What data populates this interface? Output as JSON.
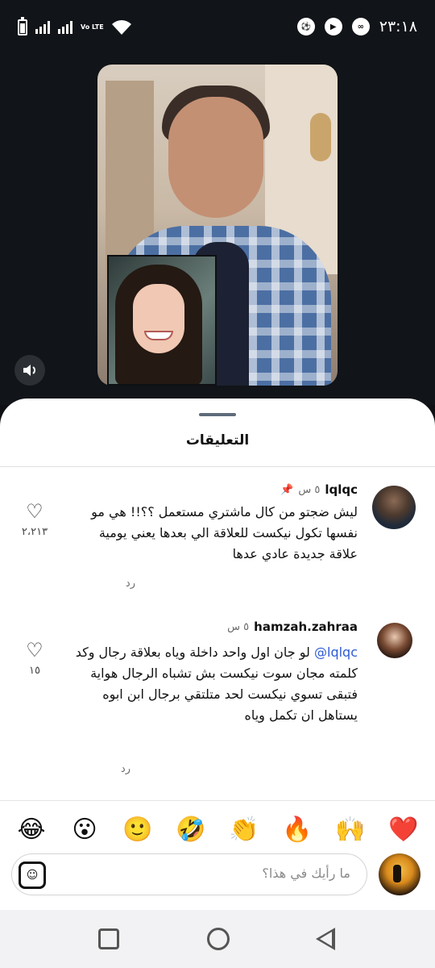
{
  "status_bar": {
    "time": "٢٣:١٨",
    "volte_label": "Vo LTE",
    "icons": [
      "battery-icon",
      "signal-icon",
      "signal-icon",
      "volte-icon",
      "wifi-icon",
      "soccer-icon",
      "youtube-icon",
      "app-icon"
    ]
  },
  "video": {
    "speaker_icon": "speaker-icon"
  },
  "sheet": {
    "title": "التعليقات"
  },
  "comments": [
    {
      "username": "lqlqc",
      "time_ago": "٥ س",
      "pinned": true,
      "text": "ليش ضجتو من كال ماشتري مستعمل ؟؟!! هي مو نفسها تكول نيكست للعلاقة الي بعدها يعني يومية علاقة جديدة عادي عدها",
      "reply_label": "رد",
      "likes": "٢،٢١٣"
    },
    {
      "username": "hamzah.zahraa",
      "time_ago": "٥ س",
      "pinned": false,
      "mention": "@lqlqc",
      "text": "لو جان اول واحد داخلة وياه بعلاقة رجال وكد كلمته مجان سوت نيكست بش تشباه الرجال هواية فتبقى تسوي نيكست لحد متلتقي برجال ابن ابوه يستاهل ان تكمل وياه",
      "reply_label": "رد",
      "likes": "١٥"
    }
  ],
  "emoji_bar": [
    "❤️",
    "🙌",
    "🔥",
    "👏",
    "🤣",
    "🙂",
    "😮",
    "😂"
  ],
  "composer": {
    "placeholder": "ما رأيك في هذا؟",
    "sticker_icon": "sticker-icon"
  },
  "colors": {
    "mention": "#2f5bd5",
    "dark_bg": "#111418"
  }
}
